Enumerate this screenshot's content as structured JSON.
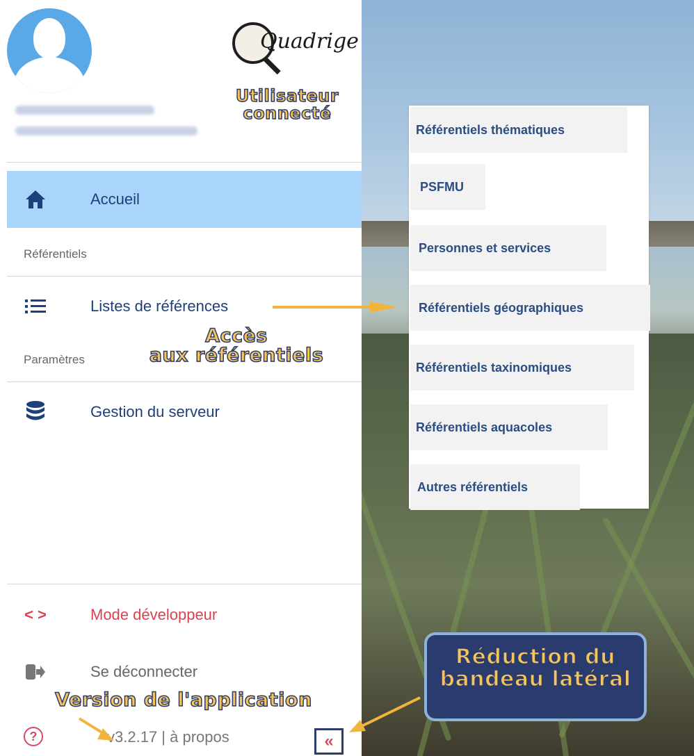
{
  "header": {
    "logo_text": "Quadrige",
    "user_caption": "Utilisateur\nconnecté"
  },
  "nav": {
    "accueil": "Accueil",
    "section_referentiels": "Référentiels",
    "listes": "Listes de références",
    "section_parametres": "Paramètres",
    "gestion": "Gestion du serveur",
    "access_caption": "Accès\naux référentiels"
  },
  "footer": {
    "dev_mode": "Mode développeur",
    "logout": "Se déconnecter",
    "version": "v3.2.17 | à propos",
    "version_caption": "Version de l'application",
    "collapse_symbol": "«"
  },
  "dropdown": {
    "items": [
      "Référentiels thématiques",
      "PSFMU",
      "Personnes et services",
      "Référentiels géographiques",
      "Référentiels taxinomiques",
      "Référentiels aquacoles",
      "Autres référentiels"
    ]
  },
  "callout": {
    "text": "Réduction du\nbandeau latéral"
  },
  "colors": {
    "active_bg": "#a9d5fb",
    "nav_text": "#1d3f7a",
    "dev_text": "#d8434f",
    "caption_fill": "#f4c55c",
    "caption_stroke": "#2d3a6b"
  }
}
